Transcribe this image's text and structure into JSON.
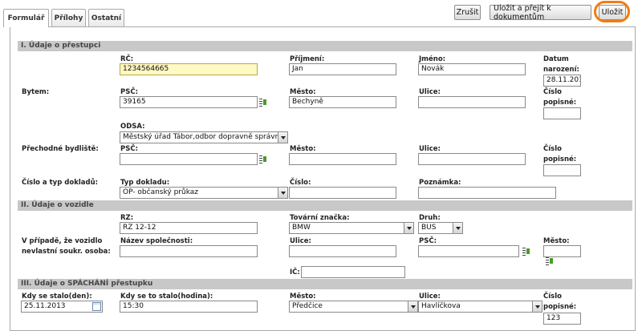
{
  "tabs": [
    "Formulář",
    "Přílohy",
    "Ostatní"
  ],
  "buttons": {
    "cancel": "Zrušit",
    "save_docs": "Uložit a přejít k dokumentům",
    "save": "Uložit"
  },
  "sections": {
    "s1": "I. Údaje o přestupci",
    "s2": "II. Údaje o vozidle",
    "s3": "III. Údaje o SPÁCHÁNÍ přestupku"
  },
  "labels": {
    "rc": "RČ:",
    "prijmeni": "Příjmení:",
    "jmeno": "Jméno:",
    "datum1": "Datum",
    "datum2": "narození:",
    "bytem": "Bytem:",
    "psc": "PSČ:",
    "mesto": "Město:",
    "ulice": "Ulice:",
    "cislo_popisne1": "Číslo",
    "cislo_popisne2": "popisné:",
    "odsa": "ODSA:",
    "prechodne": "Přechodné bydliště:",
    "doklad_row": "Číslo a typ dokladů:",
    "typ_dokladu": "Typ dokladu:",
    "cislo": "Číslo:",
    "poznamka": "Poznámka:",
    "rz": "RZ:",
    "tovarni": "Tovární značka:",
    "druh": "Druh:",
    "vpripade1": "V případě, že vozidlo",
    "vpripade2": "nevlastní soukr. osoba:",
    "nazev": "Název společnosti:",
    "ic": "IČ:",
    "kdy_den": "Kdy se stalo(den):",
    "kdy_hod": "Kdy se to stalo(hodina):"
  },
  "values": {
    "rc": "1234564665",
    "prijmeni": "Jan",
    "jmeno": "Novák",
    "datum": "28.11.2013",
    "psc": "39165",
    "mesto": "Bechyně",
    "ulice": "",
    "cislo_popisne": "",
    "odsa": "Městský úřad Tábor,odbor dopravně správních",
    "p_psc": "",
    "p_mesto": "",
    "p_ulice": "",
    "p_cislo": "",
    "typ_dokladu": "OP- občanský průkaz",
    "cislo_dokladu": "",
    "poznamka": "",
    "rz": "RZ 12-12",
    "znacka": "BMW",
    "druh": "BUS",
    "nazev": "",
    "f_ulice": "",
    "f_psc": "",
    "f_mesto": "",
    "ic": "",
    "den": "25.11.2013",
    "hodina": "15:30",
    "misto_mesto": "Předčice",
    "misto_ulice": "Havlíčkova",
    "misto_cislo": "123"
  },
  "colors": {
    "highlight": "#f07d12",
    "section_bg": "#c8c8c8",
    "yellow_field": "#fff9c4"
  }
}
